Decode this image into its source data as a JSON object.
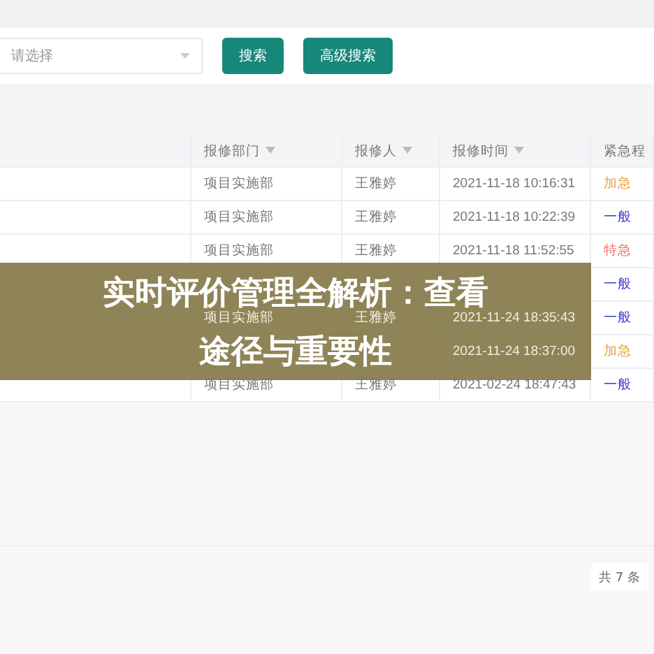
{
  "filter": {
    "select": {
      "placeholder": "请选择"
    },
    "buttons": [
      "搜索",
      "高级搜索"
    ]
  },
  "table": {
    "columns": [
      "报修部门",
      "报修人",
      "报修时间",
      "紧急程"
    ],
    "rows": [
      {
        "department": "项目实施部",
        "reporter": "王雅婷",
        "time": "2021-11-18 10:16:31",
        "urgency": "加急",
        "color": "#e6a23c"
      },
      {
        "department": "项目实施部",
        "reporter": "王雅婷",
        "time": "2021-11-18 10:22:39",
        "urgency": "一般",
        "color": "#3b3bd1"
      },
      {
        "department": "项目实施部",
        "reporter": "王雅婷",
        "time": "2021-11-18 11:52:55",
        "urgency": "特急",
        "color": "#f56c6c"
      },
      {
        "urgency": "一般",
        "color": "#3b3bd1"
      },
      {
        "department": "项目实施部",
        "reporter": "王雅婷",
        "time": "2021-11-24 18:35:43",
        "urgency": "一般",
        "color": "#3b3bd1"
      },
      {
        "time": "2021-11-24 18:37:00",
        "urgency": "加急",
        "color": "#e6a23c"
      },
      {
        "department": "项目实施部",
        "reporter": "王雅婷",
        "time": "2021-02-24 18:47:43",
        "urgency": "一般",
        "color": "#3b3bd1"
      }
    ]
  },
  "banner": {
    "lines": [
      "实时评价管理全解析：查看",
      "途径与重要性"
    ]
  },
  "footer": {
    "total": "共 7 条"
  }
}
